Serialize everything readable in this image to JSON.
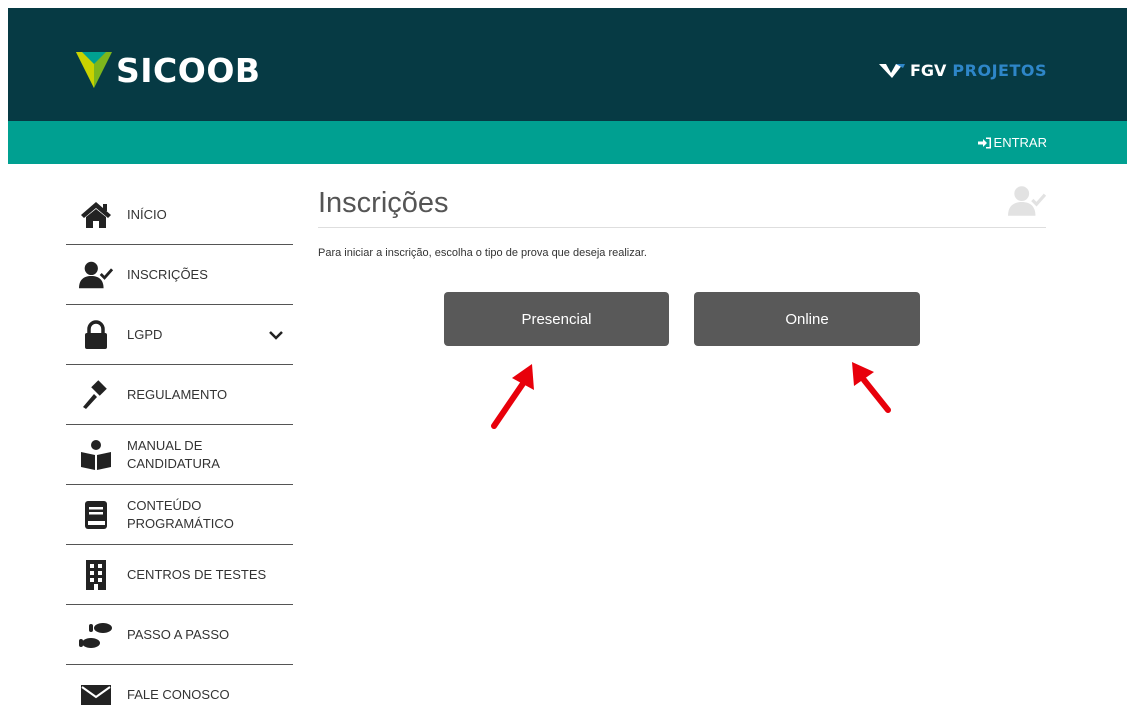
{
  "header": {
    "brand": "SICOOB",
    "partner_fgv": "FGV",
    "partner_projetos": "PROJETOS",
    "login_label": "ENTRAR"
  },
  "sidebar": {
    "items": [
      {
        "label": "INÍCIO",
        "icon": "home-icon"
      },
      {
        "label": "INSCRIÇÕES",
        "icon": "user-check-icon"
      },
      {
        "label": "LGPD",
        "icon": "lock-icon"
      },
      {
        "label": "REGULAMENTO",
        "icon": "gavel-icon"
      },
      {
        "label": "MANUAL DE\nCANDIDATURA",
        "icon": "reader-icon"
      },
      {
        "label": "CONTEÚDO\nPROGRAMÁTICO",
        "icon": "book-icon"
      },
      {
        "label": "CENTROS DE TESTES",
        "icon": "building-icon"
      },
      {
        "label": "PASSO A PASSO",
        "icon": "footsteps-icon"
      },
      {
        "label": "FALE CONOSCO",
        "icon": "envelope-icon"
      }
    ]
  },
  "main": {
    "title": "Inscrições",
    "instructions": "Para iniciar a inscrição, escolha o tipo de prova que deseja realizar.",
    "buttons": {
      "presencial": "Presencial",
      "online": "Online"
    }
  },
  "colors": {
    "header_dark": "#063a44",
    "header_green": "#00a091",
    "button_gray": "#595959",
    "arrow_red": "#e8000b",
    "projetos_blue": "#2e86c8"
  }
}
